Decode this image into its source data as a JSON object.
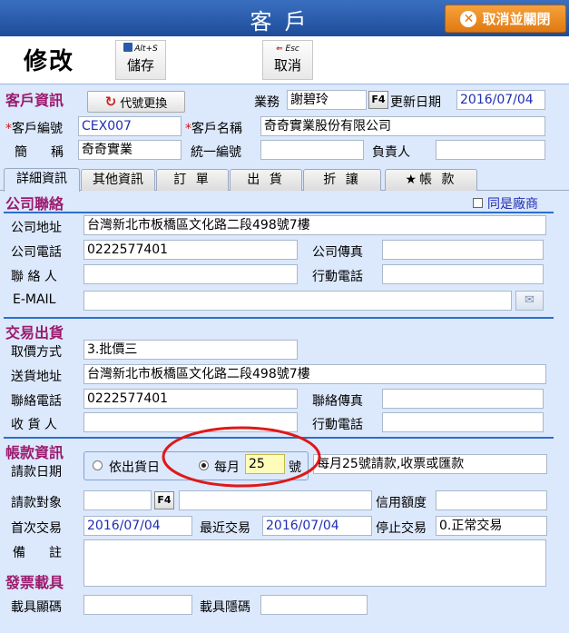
{
  "window": {
    "title": "客戶",
    "close_button": "取消並關閉"
  },
  "toolbar": {
    "mode": "修改",
    "save": {
      "hotkey": "Alt+S",
      "label": "儲存"
    },
    "cancel": {
      "hotkey": "Esc",
      "label": "取消"
    }
  },
  "customer": {
    "section_title": "客戶資訊",
    "code_change_button": "代號更換",
    "sales_label": "業務",
    "sales_value": "謝碧玲",
    "f4": "F4",
    "update_date_label": "更新日期",
    "update_date_value": "2016/07/04",
    "code_label": "客戶編號",
    "code_value": "CEX007",
    "name_label": "客戶名稱",
    "name_value": "奇奇實業股份有限公司",
    "short_label": "簡　稱",
    "short_value": "奇奇實業",
    "tax_id_label": "統一編號",
    "tax_id_value": "",
    "owner_label": "負責人",
    "owner_value": ""
  },
  "tabs": [
    "詳細資訊",
    "其他資訊",
    "訂 單",
    "出 貨",
    "折 讓",
    "★帳 款"
  ],
  "company": {
    "section_title": "公司聯絡",
    "same_as_vendor_label": "同是廠商",
    "same_as_vendor_checked": false,
    "address_label": "公司地址",
    "address_value": "台灣新北市板橋區文化路二段498號7樓",
    "phone_label": "公司電話",
    "phone_value": "0222577401",
    "fax_label": "公司傳真",
    "fax_value": "",
    "contact_label": "聯 絡 人",
    "contact_value": "",
    "mobile_label": "行動電話",
    "mobile_value": "",
    "email_label": "E-MAIL",
    "email_value": ""
  },
  "trade": {
    "section_title": "交易出貨",
    "price_method_label": "取價方式",
    "price_method_value": "3.批價三",
    "ship_address_label": "送貨地址",
    "ship_address_value": "台灣新北市板橋區文化路二段498號7樓",
    "contact_phone_label": "聯絡電話",
    "contact_phone_value": "0222577401",
    "contact_fax_label": "聯絡傳真",
    "contact_fax_value": "",
    "receiver_label": "收 貨 人",
    "receiver_value": "",
    "mobile_label": "行動電話",
    "mobile_value": ""
  },
  "billing": {
    "section_title": "帳款資訊",
    "bill_date_label": "請款日期",
    "radio_ship_date": "依出貨日",
    "radio_monthly": "每月",
    "monthly_day": "25",
    "day_suffix": "號",
    "selected": "monthly",
    "bill_note_value": "每月25號請款,收票或匯款",
    "bill_target_label": "請款對象",
    "bill_target_value": "",
    "bill_target_name": "",
    "credit_label": "信用額度",
    "credit_value": "",
    "first_trade_label": "首次交易",
    "first_trade_value": "2016/07/04",
    "last_trade_label": "最近交易",
    "last_trade_value": "2016/07/04",
    "stop_trade_label": "停止交易",
    "stop_trade_value": "0.正常交易",
    "remark_label": "備　註",
    "remark_value": ""
  },
  "invoice": {
    "section_title": "發票載具",
    "carrier_display_label": "載具顯碼",
    "carrier_display_value": "",
    "carrier_hidden_label": "載具隱碼",
    "carrier_hidden_value": ""
  },
  "colors": {
    "title_bar": "#2a5cab",
    "close_button": "#ee8b22",
    "panel": "#dce8fb",
    "section": "#9b1b6e",
    "highlight_ellipse": "#e01818",
    "date_text": "#1f2db5"
  }
}
